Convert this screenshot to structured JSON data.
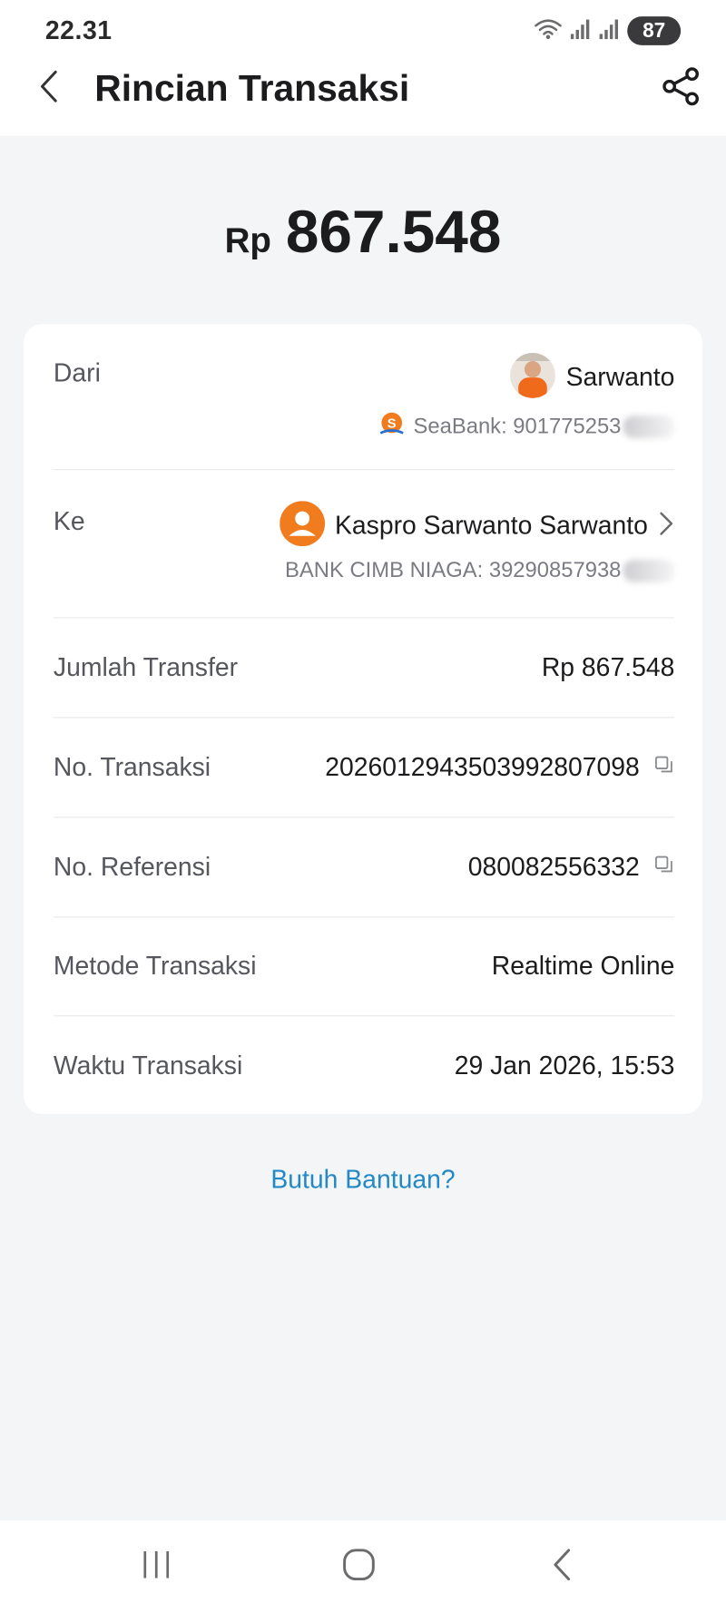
{
  "status_bar": {
    "time": "22.31",
    "battery": "87"
  },
  "header": {
    "title": "Rincian Transaksi"
  },
  "amount": {
    "currency": "Rp",
    "value": "867.548"
  },
  "details": {
    "from": {
      "label": "Dari",
      "name": "Sarwanto",
      "account": "SeaBank: 901775253"
    },
    "to": {
      "label": "Ke",
      "name": "Kaspro Sarwanto Sarwanto",
      "account": "BANK CIMB NIAGA: 39290857938"
    },
    "transfer_amount": {
      "label": "Jumlah Transfer",
      "value": "Rp 867.548"
    },
    "transaction_no": {
      "label": "No. Transaksi",
      "value": "2026012943503992807098"
    },
    "reference_no": {
      "label": "No. Referensi",
      "value": "080082556332"
    },
    "method": {
      "label": "Metode Transaksi",
      "value": "Realtime Online"
    },
    "time": {
      "label": "Waktu Transaksi",
      "value": "29 Jan 2026, 15:53"
    }
  },
  "help": {
    "label": "Butuh Bantuan?"
  },
  "colors": {
    "background": "#f4f5f7",
    "card": "#ffffff",
    "accent_orange": "#f07c1e",
    "link": "#2389c4"
  },
  "icons": {
    "back": "chevron-left-icon",
    "share": "share-icon",
    "copy": "copy-icon",
    "chevron": "chevron-right-icon",
    "nav_recent": "recent-apps-icon",
    "nav_home": "home-icon",
    "nav_back": "back-icon"
  }
}
